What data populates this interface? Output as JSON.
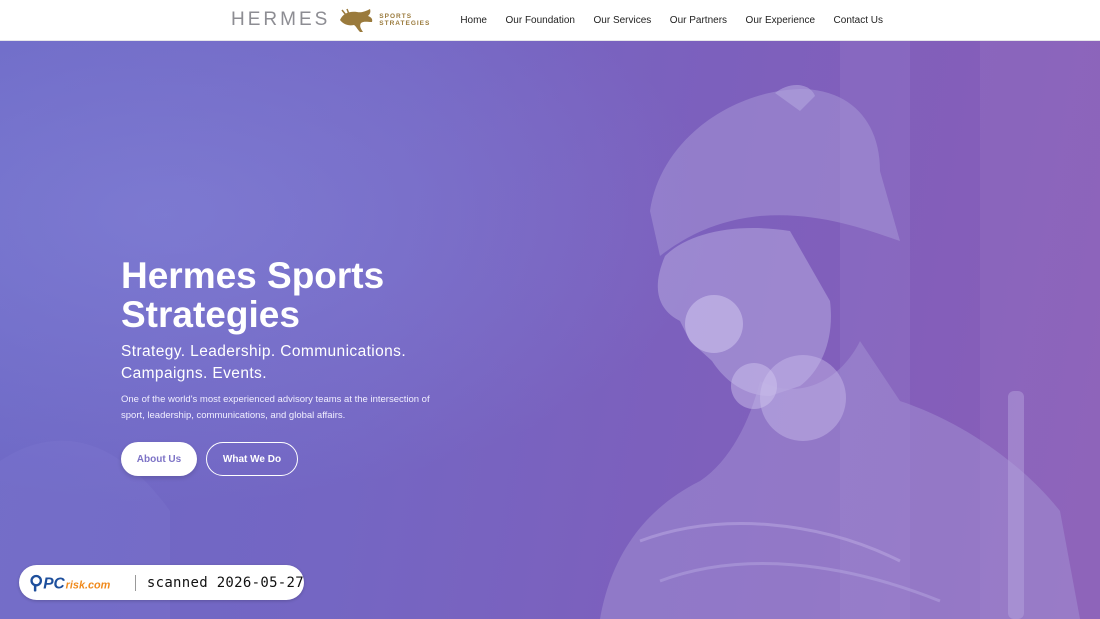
{
  "header": {
    "logo_word": "HERMES",
    "logo_tag_line1": "SPORTS",
    "logo_tag_line2": "STRATEGIES",
    "nav": [
      "Home",
      "Our Foundation",
      "Our Services",
      "Our Partners",
      "Our Experience",
      "Contact Us"
    ]
  },
  "hero": {
    "title": "Hermes Sports Strategies",
    "tagline": "Strategy. Leadership. Communications. Campaigns. Events.",
    "description": "One of the world's most experienced advisory teams at the intersection of sport, leadership, communications, and global affairs.",
    "primary_button": "About Us",
    "secondary_button": "What We Do"
  },
  "badge": {
    "brand": "PCrisk.com",
    "text": "scanned 2026-05-27"
  },
  "colors": {
    "hero_start": "#6d69c6",
    "hero_end": "#8a5db7",
    "logo_gold": "#9a7a3c",
    "logo_gray": "#8d8d93",
    "badge_brand_blue": "#1e4f9c",
    "badge_brand_orange": "#f08a1c"
  },
  "icons": [
    "hermes-horse-logo-icon",
    "pcrisk-magnifier-icon"
  ]
}
